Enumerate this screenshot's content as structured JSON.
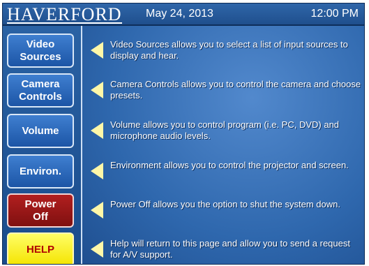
{
  "header": {
    "logo": "HAVERFORD",
    "date": "May 24, 2013",
    "time": "12:00 PM"
  },
  "colors": {
    "panel_blue": "#1b4f8e",
    "button_blue": "#2c6dc3",
    "button_red": "#9b1414",
    "button_yellow": "#fff200",
    "arrow_yellow": "#fff7a8"
  },
  "buttons": [
    {
      "label": "Video\nSources",
      "style": "blue"
    },
    {
      "label": "Camera\nControls",
      "style": "blue"
    },
    {
      "label": "Volume",
      "style": "blue"
    },
    {
      "label": "Environ.",
      "style": "blue"
    },
    {
      "label": "Power\nOff",
      "style": "red"
    },
    {
      "label": "HELP",
      "style": "yellow"
    }
  ],
  "descriptions": [
    "Video Sources allows you to select a list of input sources to display and hear.",
    "Camera Controls allows you to control the camera and choose presets.",
    "Volume allows you to control program (i.e. PC, DVD) and microphone audio levels.",
    "Environment allows you to control the projector and screen.",
    "Power Off allows you the option to shut the system down.",
    "Help will return to this page and allow you to send a request for A/V support."
  ]
}
